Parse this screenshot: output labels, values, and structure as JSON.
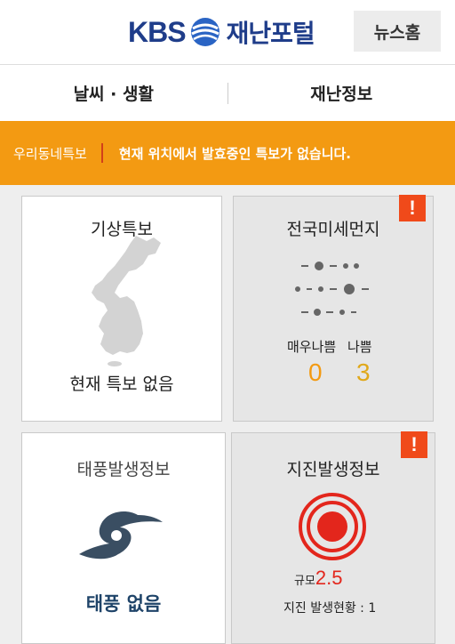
{
  "header": {
    "logo_brand": "KBS",
    "logo_title": "재난포털",
    "news_home": "뉴스홈"
  },
  "tabs": [
    "날씨 · 생활",
    "재난정보"
  ],
  "alert": {
    "label": "우리동네특보",
    "message": "현재 위치에서 발효중인 특보가 없습니다."
  },
  "cards": {
    "weather_warning": {
      "title": "기상특보",
      "status": "현재 특보 없음"
    },
    "fine_dust": {
      "title": "전국미세먼지",
      "badge": "!",
      "labels": [
        "매우나쁨",
        "나쁨"
      ],
      "values": [
        "0",
        "3"
      ]
    },
    "typhoon": {
      "title": "태풍발생정보",
      "status": "태풍 없음"
    },
    "earthquake": {
      "title": "지진발생정보",
      "badge": "!",
      "scale_label": "규모",
      "scale_value": "2.5",
      "count_label": "지진 발생현황 : 1"
    }
  },
  "colors": {
    "brand_blue": "#1f3d8a",
    "alert_orange": "#f39a12",
    "badge_red": "#f04a1a",
    "dust_orange": "#f39a12",
    "quake_red": "#e3261c",
    "typhoon_navy": "#1f4469"
  }
}
